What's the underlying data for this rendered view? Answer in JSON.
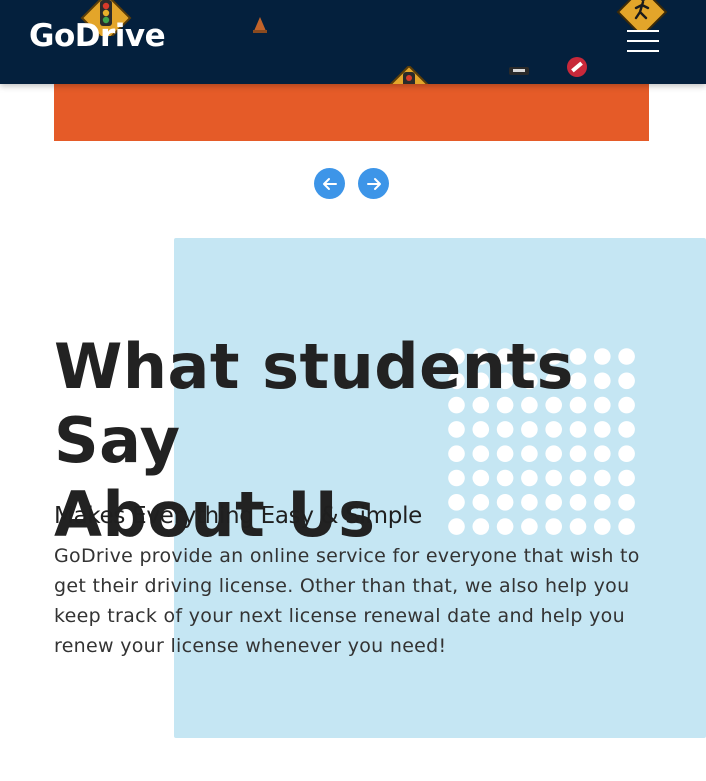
{
  "header": {
    "brand": "GoDrive",
    "menu_icon": "hamburger-menu-icon",
    "background": "#04203d"
  },
  "carousel": {
    "slide_color": "#e55b28",
    "prev_icon": "arrow-left-icon",
    "next_icon": "arrow-right-icon",
    "button_color": "#3d95e8"
  },
  "testimonials": {
    "heading_line1": "What students Say",
    "heading_line2": "About Us",
    "subheading": "Makes Everything Easy & Simple",
    "description": "GoDrive provide an online service for everyone that wish to get their driving license. Other than that, we also help you keep track of your next license renewal date and help you renew your license whenever you need!",
    "panel_color": "#c5e6f3"
  }
}
